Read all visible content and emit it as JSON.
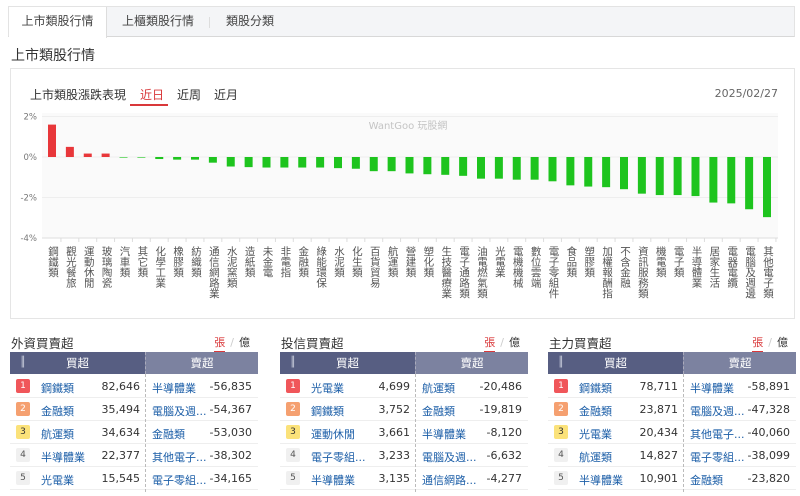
{
  "tabs": [
    {
      "label": "上市類股行情",
      "active": true
    },
    {
      "label": "上櫃類股行情",
      "active": false
    },
    {
      "label": "類股分類",
      "active": false
    }
  ],
  "page_title": "上市類股行情",
  "chart_card": {
    "title": "上市類股漲跌表現",
    "periods": [
      {
        "label": "近日",
        "active": true
      },
      {
        "label": "近周",
        "active": false
      },
      {
        "label": "近月",
        "active": false
      }
    ],
    "date": "2025/02/27",
    "watermark": "WantGoo 玩股網"
  },
  "colors": {
    "up": "#e8373a",
    "down": "#1ec41e",
    "accent": "#d9383a",
    "header_buy": "#575e82",
    "header_sell": "#7c82a0"
  },
  "chart_data": {
    "type": "bar",
    "ylim": [
      -4,
      2
    ],
    "yticks": [
      "2%",
      "0%",
      "-2%",
      "-4%"
    ],
    "ytick_values": [
      2,
      0,
      -2,
      -4
    ],
    "grid": true,
    "unit": "%",
    "categories": [
      "鋼鐵類",
      "觀光餐旅",
      "運動休閒",
      "玻璃陶瓷",
      "汽車類",
      "其它類",
      "化學工業",
      "橡膠類",
      "紡織類",
      "通信網路業",
      "水泥窯類",
      "造紙類",
      "未金電",
      "非電指",
      "金融類",
      "綠能環保",
      "水泥類",
      "化生類",
      "百貨貿易",
      "航運類",
      "營建類",
      "塑化類",
      "生技醫療業",
      "電子通路類",
      "油電燃氣類",
      "光電業",
      "電機機械",
      "數位雲端",
      "電子零組件",
      "食品類",
      "塑膠類",
      "加權報酬指",
      "不含金融",
      "資訊服務類",
      "機電類",
      "電子類",
      "半導體業",
      "居家生活",
      "電器電纜",
      "電腦及週邊",
      "其他電子類"
    ],
    "values": [
      1.6,
      0.5,
      0.17,
      0.17,
      0.0,
      -0.03,
      -0.1,
      -0.13,
      -0.13,
      -0.28,
      -0.47,
      -0.5,
      -0.52,
      -0.52,
      -0.52,
      -0.52,
      -0.55,
      -0.58,
      -0.7,
      -0.7,
      -0.81,
      -0.85,
      -0.88,
      -0.93,
      -1.07,
      -1.07,
      -1.12,
      -1.12,
      -1.2,
      -1.4,
      -1.46,
      -1.49,
      -1.59,
      -1.81,
      -1.88,
      -1.88,
      -1.93,
      -2.25,
      -2.29,
      -2.58,
      -2.97
    ]
  },
  "panels": [
    {
      "title": "外資買賣超",
      "unit_on": "張",
      "unit_off": "億",
      "buy_header": "買超",
      "sell_header": "賣超",
      "rows": [
        {
          "rank": "1",
          "buy": "鋼鐵類",
          "buy_val": "82,646",
          "sell": "半導體業",
          "sell_val": "-56,835"
        },
        {
          "rank": "2",
          "buy": "金融類",
          "buy_val": "35,494",
          "sell": "電腦及週...",
          "sell_val": "-54,367"
        },
        {
          "rank": "3",
          "buy": "航運類",
          "buy_val": "34,634",
          "sell": "金融類",
          "sell_val": "-53,030"
        },
        {
          "rank": "4",
          "buy": "半導體業",
          "buy_val": "22,377",
          "sell": "其他電子...",
          "sell_val": "-38,302"
        },
        {
          "rank": "5",
          "buy": "光電業",
          "buy_val": "15,545",
          "sell": "電子零組...",
          "sell_val": "-34,165"
        }
      ]
    },
    {
      "title": "投信買賣超",
      "unit_on": "張",
      "unit_off": "億",
      "buy_header": "買超",
      "sell_header": "賣超",
      "rows": [
        {
          "rank": "1",
          "buy": "光電業",
          "buy_val": "4,699",
          "sell": "航運類",
          "sell_val": "-20,486"
        },
        {
          "rank": "2",
          "buy": "鋼鐵類",
          "buy_val": "3,752",
          "sell": "金融類",
          "sell_val": "-19,819"
        },
        {
          "rank": "3",
          "buy": "運動休閒",
          "buy_val": "3,661",
          "sell": "半導體業",
          "sell_val": "-8,120"
        },
        {
          "rank": "4",
          "buy": "電子零組...",
          "buy_val": "3,233",
          "sell": "電腦及週...",
          "sell_val": "-6,632"
        },
        {
          "rank": "5",
          "buy": "半導體業",
          "buy_val": "3,135",
          "sell": "通信網路...",
          "sell_val": "-4,277"
        }
      ]
    },
    {
      "title": "主力買賣超",
      "unit_on": "張",
      "unit_off": "億",
      "buy_header": "買超",
      "sell_header": "賣超",
      "rows": [
        {
          "rank": "1",
          "buy": "鋼鐵類",
          "buy_val": "78,711",
          "sell": "半導體業",
          "sell_val": "-58,891"
        },
        {
          "rank": "2",
          "buy": "金融類",
          "buy_val": "23,871",
          "sell": "電腦及週...",
          "sell_val": "-47,328"
        },
        {
          "rank": "3",
          "buy": "光電業",
          "buy_val": "20,434",
          "sell": "其他電子...",
          "sell_val": "-40,060"
        },
        {
          "rank": "4",
          "buy": "航運類",
          "buy_val": "14,827",
          "sell": "電子零組...",
          "sell_val": "-38,099"
        },
        {
          "rank": "5",
          "buy": "半導體業",
          "buy_val": "10,901",
          "sell": "金融類",
          "sell_val": "-23,820"
        }
      ]
    }
  ]
}
